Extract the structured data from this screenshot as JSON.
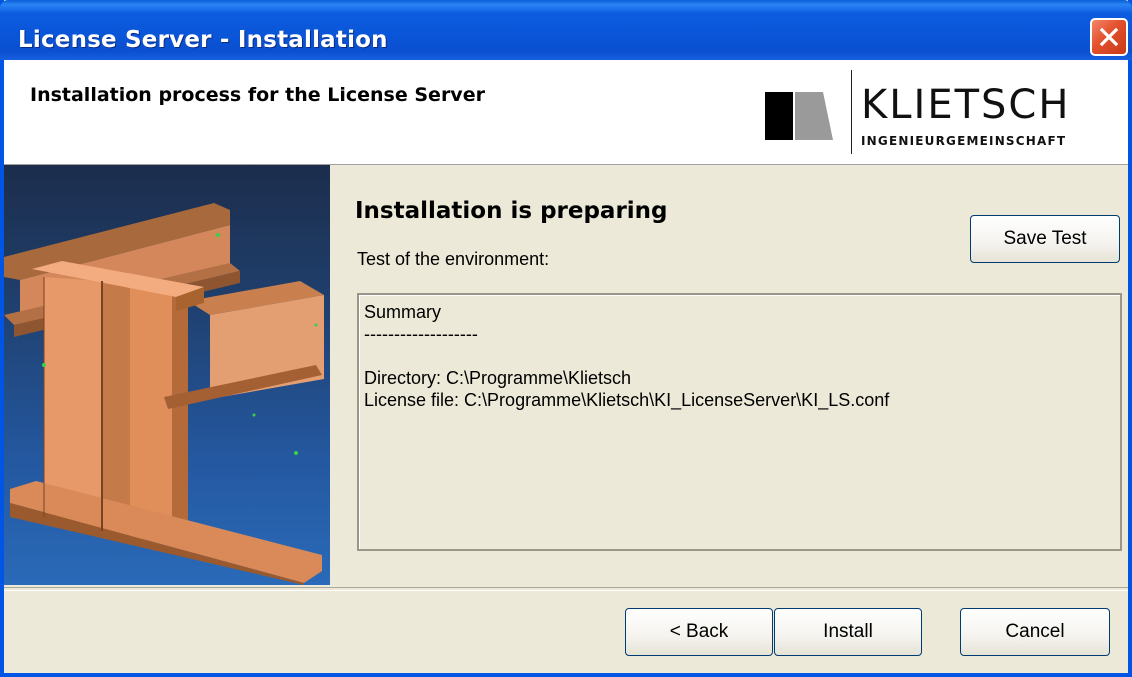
{
  "window": {
    "title": "License Server - Installation"
  },
  "header": {
    "title": "Installation process for the License Server",
    "logo": {
      "word": "KLIETSCH",
      "subtitle": "INGENIEURGEMEINSCHAFT"
    }
  },
  "main": {
    "heading": "Installation is preparing",
    "subheading": "Test of the environment:",
    "save_test_label": "Save Test",
    "output_lines": [
      "Summary",
      "-------------------",
      "",
      "Directory: C:\\Programme\\Klietsch",
      "License file: C:\\Programme\\Klietsch\\KI_LicenseServer\\KI_LS.conf"
    ]
  },
  "footer": {
    "back_label": "< Back",
    "install_label": "Install",
    "cancel_label": "Cancel"
  },
  "colors": {
    "titlebar": "#0a55d8",
    "dialog_bg": "#ece9d8",
    "close_button": "#e2502c",
    "beam": "#e08f5a"
  },
  "icons": {
    "close": "close-icon",
    "logo_mark": "klietsch-logo-mark"
  }
}
